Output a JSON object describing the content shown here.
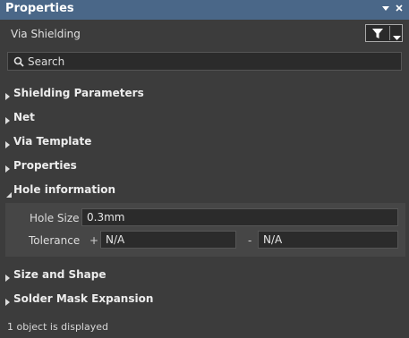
{
  "panel": {
    "title": "Properties"
  },
  "subheader": {
    "object_type": "Via Shielding"
  },
  "search": {
    "placeholder": "Search"
  },
  "sections": {
    "shielding_parameters": "Shielding Parameters",
    "net": "Net",
    "via_template": "Via Template",
    "properties": "Properties",
    "hole_information": "Hole information",
    "size_and_shape": "Size and Shape",
    "solder_mask_expansion": "Solder Mask Expansion"
  },
  "hole_information": {
    "hole_size_label": "Hole Size",
    "hole_size_value": "0.3mm",
    "tolerance_label": "Tolerance",
    "plus_sign": "+",
    "plus_value": "N/A",
    "minus_sign": "-",
    "minus_value": "N/A"
  },
  "status": {
    "text": "1 object is displayed"
  },
  "colors": {
    "titlebar": "#4a6788",
    "panel_bg": "#3c3c3c",
    "field_bg": "#2b2b2b"
  }
}
